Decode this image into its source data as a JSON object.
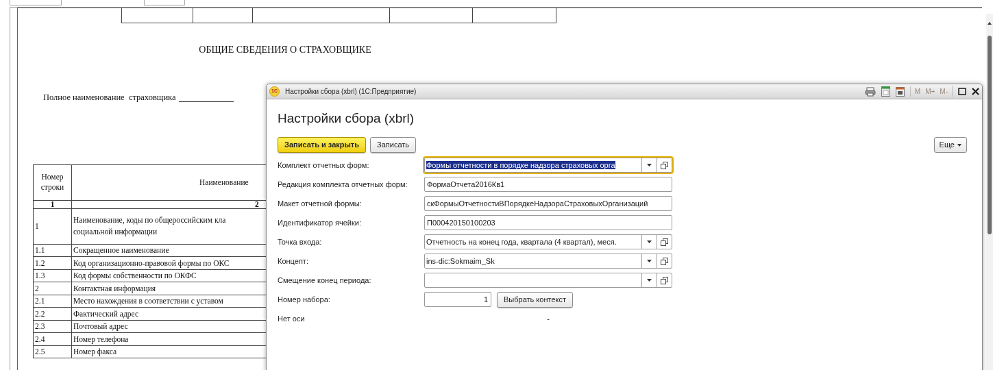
{
  "document": {
    "title": "ОБЩИЕ СВЕДЕНИЯ О СТРАХОВЩИКЕ",
    "insurer_label": "Полное наименование  страховщика",
    "table": {
      "columns": [
        "Номер строки",
        "Наименование"
      ],
      "index_row": [
        "1",
        "2"
      ],
      "rows": [
        {
          "number": "1",
          "name": "Наименование, коды по общероссийским кла",
          "name_line2": "социальной информации"
        },
        {
          "number": "1.1",
          "name": "Сокращенное наименование"
        },
        {
          "number": "1.2",
          "name": "Код организационно-правовой формы по ОКС"
        },
        {
          "number": "1.3",
          "name": "Код формы собственности по ОКФС"
        },
        {
          "number": "2",
          "name": "Контактная информация"
        },
        {
          "number": "2.1",
          "name": "Место нахождения в соответствии с уставом"
        },
        {
          "number": "2.2",
          "name": "Фактический адрес"
        },
        {
          "number": "2.3",
          "name": "Почтовый адрес"
        },
        {
          "number": "2.4",
          "name": "Номер телефона"
        },
        {
          "number": "2.5",
          "name": "Номер факса"
        }
      ]
    }
  },
  "dialog": {
    "window_title": "Настройки сбора (xbrl)  (1С:Предприятие)",
    "logo": "1С",
    "memory_buttons": [
      "M",
      "M+",
      "M-"
    ],
    "heading": "Настройки сбора (xbrl)",
    "buttons": [
      {
        "label": "Записать и закрыть",
        "kind": "primary"
      },
      {
        "label": "Записать",
        "kind": "normal"
      }
    ],
    "more_button": "Еще",
    "fields": [
      {
        "kind": "select",
        "label": "Комплект отчетных форм:",
        "value": "Формы отчетности в порядке надзора страховых орга",
        "focused": true
      },
      {
        "kind": "text",
        "label": "Редакция комплекта отчетных форм:",
        "value": "ФормаОтчета2016Кв1"
      },
      {
        "kind": "text",
        "label": "Макет отчетной формы:",
        "value": "скФормыОтчетностиВПорядкеНадзораСтраховыхОрганизаций"
      },
      {
        "kind": "text",
        "label": "Идентификатор ячейки:",
        "value": "П000420150100203"
      },
      {
        "kind": "select",
        "label": "Точка входа:",
        "value": "Отчетность на конец года, квартала (4 квартал), меся.",
        "focused": false
      },
      {
        "kind": "select",
        "label": "Концепт:",
        "value": "ins-dic:Sokmaim_Sk",
        "focused": false
      },
      {
        "kind": "select",
        "label": "Смещение конец периода:",
        "focused": false
      },
      {
        "kind": "number",
        "label": "Номер набора:",
        "value": "1",
        "button": "Выбрать контекст"
      },
      {
        "kind": "static",
        "label": "Нет оси",
        "value": "-"
      }
    ]
  }
}
